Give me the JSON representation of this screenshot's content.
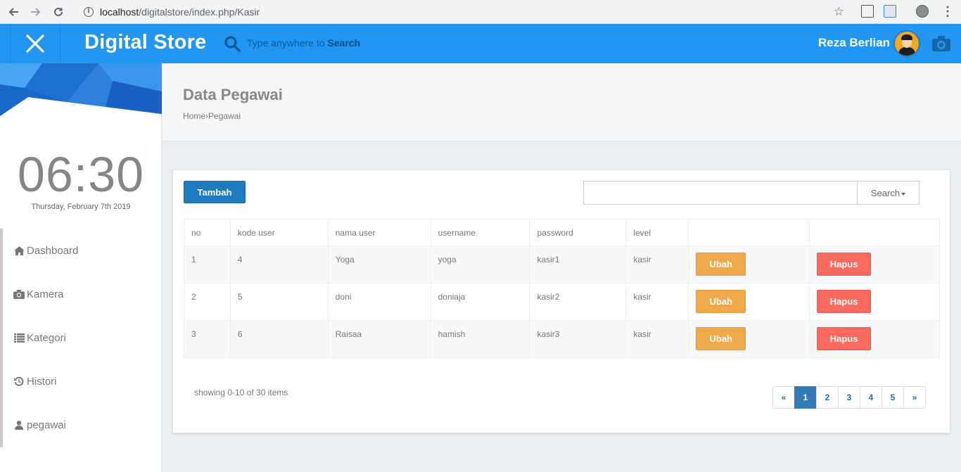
{
  "browser": {
    "url_host": "localhost",
    "url_path": "/digitalstore/index.php/Kasir"
  },
  "header": {
    "brand": "Digital Store",
    "search_prefix": "Type anywhere to ",
    "search_keyword": "Search",
    "user_name": "Reza Berlian",
    "accent_color": "#2196f3"
  },
  "sidebar": {
    "time": "06:30",
    "date": "Thursday, February 7th 2019",
    "items": [
      {
        "label": "Dashboard",
        "icon": "home-icon"
      },
      {
        "label": "Kamera",
        "icon": "camera-icon"
      },
      {
        "label": "Kategori",
        "icon": "list-icon"
      },
      {
        "label": "Histori",
        "icon": "history-icon"
      },
      {
        "label": "pegawai",
        "icon": "user-icon"
      }
    ]
  },
  "page": {
    "title": "Data Pegawai",
    "breadcrumb_home": "Home",
    "breadcrumb_sep": "›",
    "breadcrumb_current": "Pegawai"
  },
  "toolbar": {
    "add_label": "Tambah",
    "search_value": "",
    "search_button": "Search"
  },
  "table": {
    "headers": [
      "no",
      "kode user",
      "nama user",
      "username",
      "password",
      "level",
      "",
      ""
    ],
    "rows": [
      {
        "no": "1",
        "kode": "4",
        "nama": "Yoga",
        "username": "yoga",
        "password": "kasir1",
        "level": "kasir"
      },
      {
        "no": "2",
        "kode": "5",
        "nama": "doni",
        "username": "doniaja",
        "password": "kasir2",
        "level": "kasir"
      },
      {
        "no": "3",
        "kode": "6",
        "nama": "Raisaa",
        "username": "hamish",
        "password": "kasir3",
        "level": "kasir"
      }
    ],
    "edit_label": "Ubah",
    "delete_label": "Hapus"
  },
  "footer": {
    "showing": "showing 0-10 of 30 items",
    "pages": [
      "«",
      "1",
      "2",
      "3",
      "4",
      "5",
      "»"
    ],
    "active_page": "1"
  }
}
